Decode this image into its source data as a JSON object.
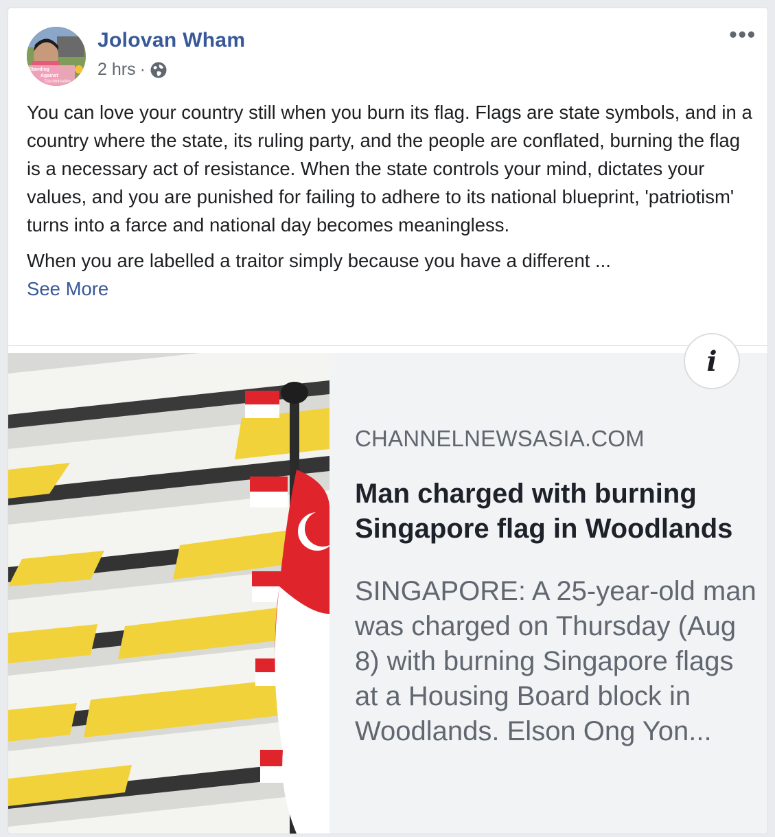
{
  "post": {
    "author": "Jolovan Wham",
    "time": "2 hrs",
    "separator": "·",
    "privacy_icon": "globe-icon",
    "more_icon": "more-options-icon",
    "more_label": "•••",
    "avatar_caption": [
      "Standing",
      "Against",
      "Discrimination"
    ],
    "paragraph1": "You can love your country still when you burn its flag. Flags are state symbols, and in a country where the state, its ruling party, and the people are conflated, burning the flag is a necessary act of resistance. When the state controls your mind, dictates your values, and you are punished for failing to adhere to its national blueprint, 'patriotism' turns into a farce and national day becomes meaningless.",
    "paragraph2": "When you are labelled a traitor simply because you have a different ...",
    "see_more": "See More"
  },
  "link": {
    "info_icon": "info-icon",
    "info_label": "i",
    "domain": "CHANNELNEWSASIA.COM",
    "headline": "Man charged with burning Singapore flag in Woodlands",
    "summary": "SINGAPORE: A 25-year-old man was charged on Thursday (Aug 8) with burning Singapore flags at a Housing Board block in Woodlands. Elson Ong Yon..."
  },
  "colors": {
    "author_link": "#385898",
    "text": "#1c1e21",
    "secondary_text": "#606770",
    "link_panel_bg": "#f2f3f5",
    "flag_red": "#e0242b",
    "balcony_yellow": "#f2d23a"
  }
}
